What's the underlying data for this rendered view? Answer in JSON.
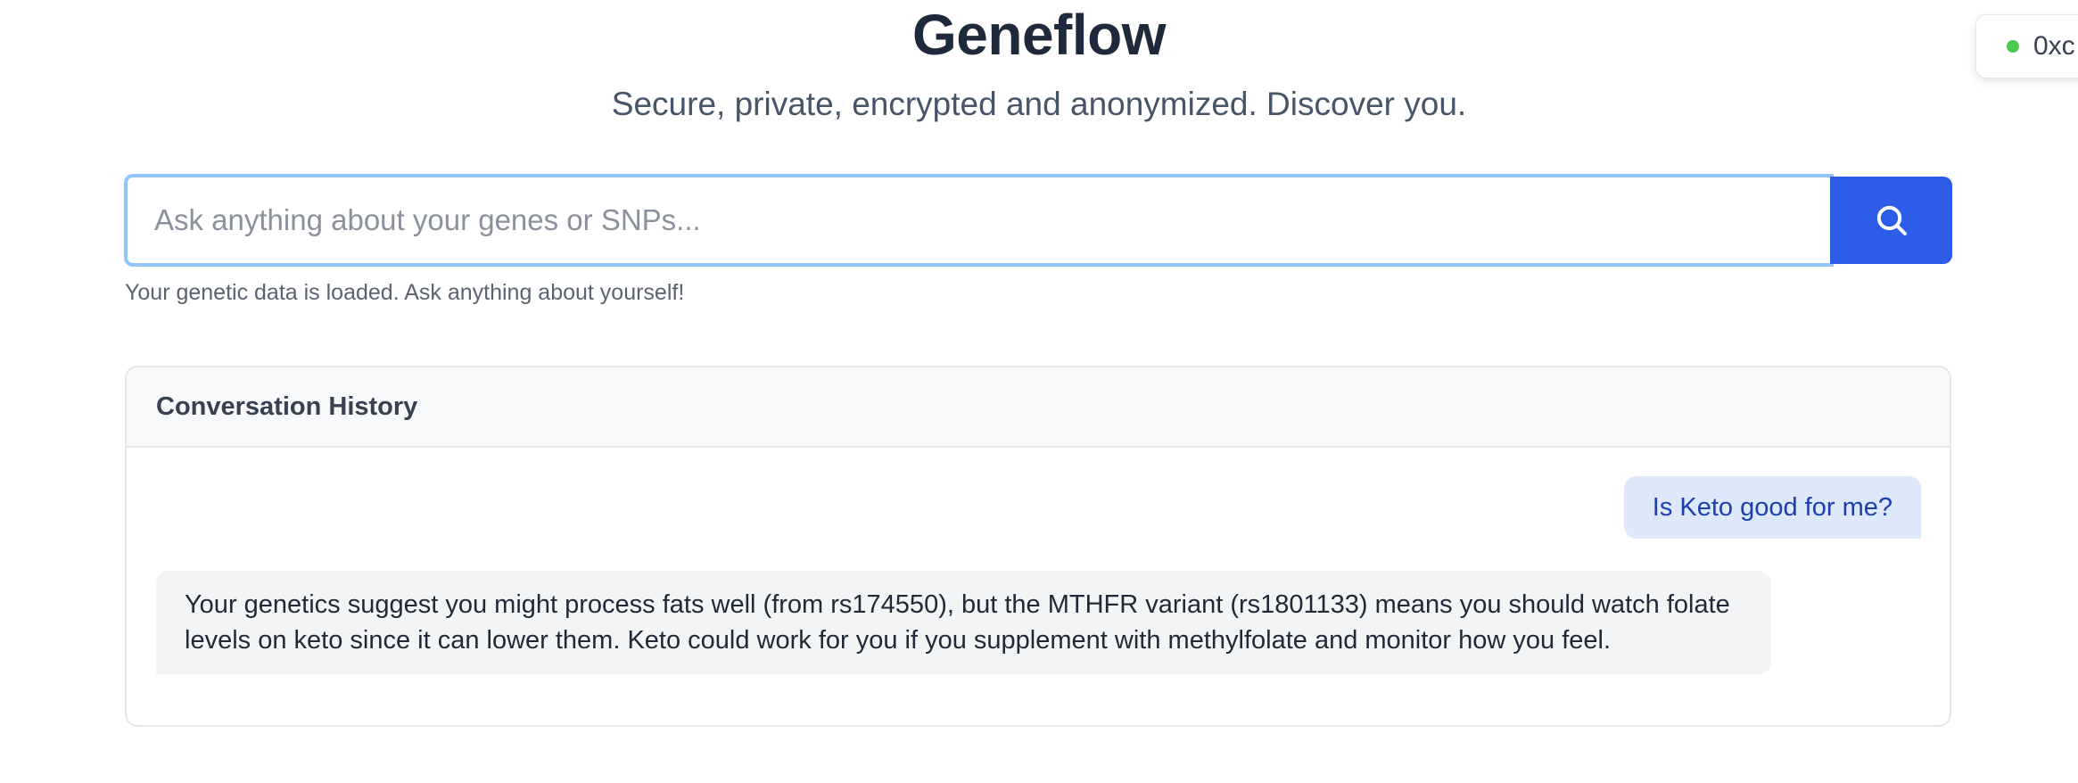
{
  "app": {
    "title": "Geneflow",
    "subtitle": "Secure, private, encrypted and anonymized. Discover you."
  },
  "wallet": {
    "address": "0xc",
    "status_color": "#4cc94e"
  },
  "search": {
    "placeholder": "Ask anything about your genes or SNPs...",
    "value": "",
    "button_icon": "search-icon",
    "button_color": "#2c5ce8",
    "hint": "Your genetic data is loaded. Ask anything about yourself!"
  },
  "history": {
    "title": "Conversation History",
    "messages": [
      {
        "role": "user",
        "text": "Is Keto good for me?"
      },
      {
        "role": "assistant",
        "text": "Your genetics suggest you might process fats well (from rs174550), but the MTHFR variant (rs1801133) means you should watch folate levels on keto since it can lower them. Keto could work for you if you supplement with methylfolate and monitor how you feel."
      }
    ]
  }
}
